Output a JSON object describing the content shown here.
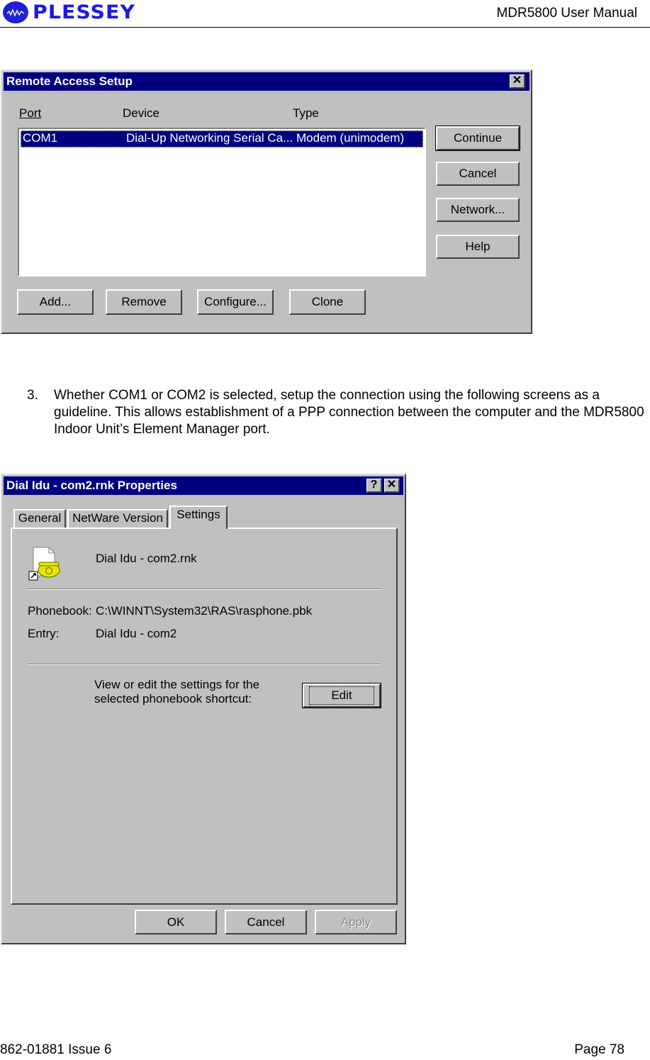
{
  "page_header": {
    "logo_text": "PLESSEY",
    "manual_title": "MDR5800 User Manual"
  },
  "remote_access_dialog": {
    "title": "Remote Access Setup",
    "columns": [
      "Port",
      "Device",
      "Type"
    ],
    "rows": [
      {
        "port": "COM1",
        "device": "Dial-Up Networking Serial Ca...",
        "type": "Modem (unimodem)",
        "selected": true
      }
    ],
    "side_buttons": [
      "Continue",
      "Cancel",
      "Network...",
      "Help"
    ],
    "bottom_buttons": [
      "Add...",
      "Remove",
      "Configure...",
      "Clone"
    ],
    "close_glyph": "✕"
  },
  "instruction": {
    "number": "3.",
    "text": "Whether COM1 or COM2 is selected, setup the connection using the following screens as a guideline.  This allows establishment of a PPP connection between the computer and the MDR5800 Indoor Unit’s Element Manager port."
  },
  "properties_dialog": {
    "title": "Dial Idu - com2.rnk Properties",
    "help_glyph": "?",
    "close_glyph": "✕",
    "tabs": [
      {
        "label": "General",
        "active": false
      },
      {
        "label": "NetWare Version",
        "active": false
      },
      {
        "label": "Settings",
        "active": true
      }
    ],
    "file_name": "Dial Idu - com2.rnk",
    "phonebook_label": "Phonebook:",
    "phonebook_value": "C:\\WINNT\\System32\\RAS\\rasphone.pbk",
    "entry_label": "Entry:",
    "entry_value": "Dial Idu - com2",
    "edit_prompt_line1": "View or edit the settings for the",
    "edit_prompt_line2": "selected phonebook shortcut:",
    "edit_button": "Edit",
    "footer_buttons": [
      {
        "label": "OK",
        "enabled": true
      },
      {
        "label": "Cancel",
        "enabled": true
      },
      {
        "label": "Apply",
        "enabled": false
      }
    ]
  },
  "page_footer": {
    "doc_id": "862-01881 Issue 6",
    "page": "Page 78"
  }
}
